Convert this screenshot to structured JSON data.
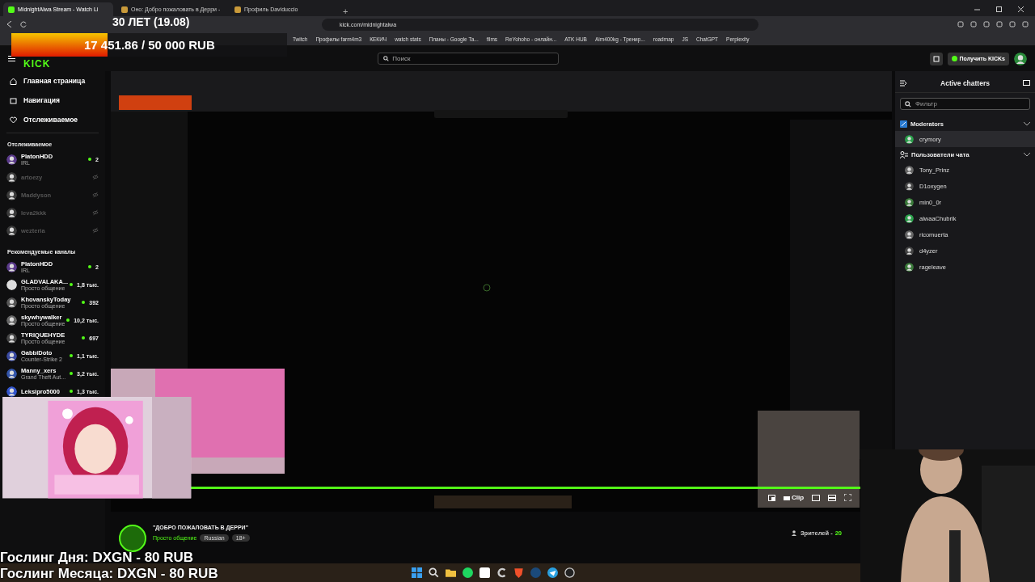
{
  "browser": {
    "tabs": [
      {
        "title": "MidnightAlwa Stream - Watch Li",
        "selected": true
      },
      {
        "title": "Оно: Добро пожаловать в Дерри -",
        "selected": false
      },
      {
        "title": "Профиль Daviduccio",
        "selected": false
      }
    ],
    "new_tab": "+",
    "address": "kick.com/midnightalwa",
    "bookmarks": [
      "Twitch",
      "Профилы farm4m3",
      "КЕКИЧ",
      "watch stats",
      "Планы - Google Ta...",
      "films",
      "ReYohoho - онлайн...",
      "ATK HUB",
      "Aim400kg - Тренир...",
      "roadmap",
      "JS",
      "ChatGPT",
      "Perplexity"
    ]
  },
  "header": {
    "logo": "KICK",
    "search_placeholder": "Поиск",
    "get_button": "Получить KICKs"
  },
  "nav": [
    "Главная страница",
    "Навигация",
    "Отслеживаемое"
  ],
  "followed": {
    "title": "Отслеживаемое",
    "channels": [
      {
        "name": "PlatonHDD",
        "category": "IRL",
        "viewers": "2",
        "live": true
      },
      {
        "name": "artoezy",
        "live": false
      },
      {
        "name": "Maddyson",
        "live": false
      },
      {
        "name": "leva2kkk",
        "live": false
      },
      {
        "name": "wezteria",
        "live": false
      }
    ]
  },
  "recommended": {
    "title": "Рекомендуемые каналы",
    "channels": [
      {
        "name": "PlatonHDD",
        "category": "IRL",
        "viewers": "2",
        "live": true
      },
      {
        "name": "GLADVALAKA...",
        "category": "Просто общение",
        "viewers": "1,8 тыс.",
        "live": true
      },
      {
        "name": "KhovanskyToday",
        "category": "Просто общение",
        "viewers": "392",
        "live": true
      },
      {
        "name": "skywhywalker",
        "category": "Просто общение",
        "viewers": "10,2 тыс.",
        "live": true
      },
      {
        "name": "TYRIQUEHYDE",
        "category": "Просто общение",
        "viewers": "697",
        "live": true
      },
      {
        "name": "GabbiDoto",
        "category": "Counter-Strike 2",
        "viewers": "1,1 тыс.",
        "live": true
      },
      {
        "name": "Manny_xers",
        "category": "Grand Theft Aut...",
        "viewers": "3,2 тыс.",
        "live": true
      },
      {
        "name": "Leksipro5000",
        "viewers": "1,3 тыс.",
        "live": true
      }
    ]
  },
  "player": {
    "clip": "Clip"
  },
  "stream": {
    "title": "\"ДОБРО ПОЖАЛОВАТЬ В ДЕРРИ\"",
    "category": "Просто общение",
    "tags": [
      "Russian",
      "18+"
    ],
    "viewers_label": "Зрителей - ",
    "viewers": "20"
  },
  "chatters": {
    "title": "Active chatters",
    "filter_placeholder": "Фильтр",
    "groups": [
      {
        "name": "Moderators",
        "kind": "moderators",
        "users": [
          {
            "name": "crymory",
            "highlighted": true
          }
        ]
      },
      {
        "name": "Пользователи чата",
        "kind": "users",
        "users": [
          {
            "name": "Tony_Prinz",
            "highlighted": false
          },
          {
            "name": "D1oxygen",
            "highlighted": false
          },
          {
            "name": "min0_0r",
            "highlighted": false
          },
          {
            "name": "alwaaChubrik",
            "highlighted": false
          },
          {
            "name": "ricomuerta",
            "highlighted": false
          },
          {
            "name": "d4yzer",
            "highlighted": false
          },
          {
            "name": "rageleave",
            "highlighted": false
          }
        ]
      }
    ]
  },
  "overlay": {
    "goal_title": "30 ЛЕТ (19.08)",
    "goal_amount": "17 451.86 / 50 000 RUB",
    "level": 0.35,
    "lines": [
      "Гослинг Дня: DXGN - 80 RUB",
      "Гослинг Месяца: DXGN - 80 RUB"
    ]
  }
}
